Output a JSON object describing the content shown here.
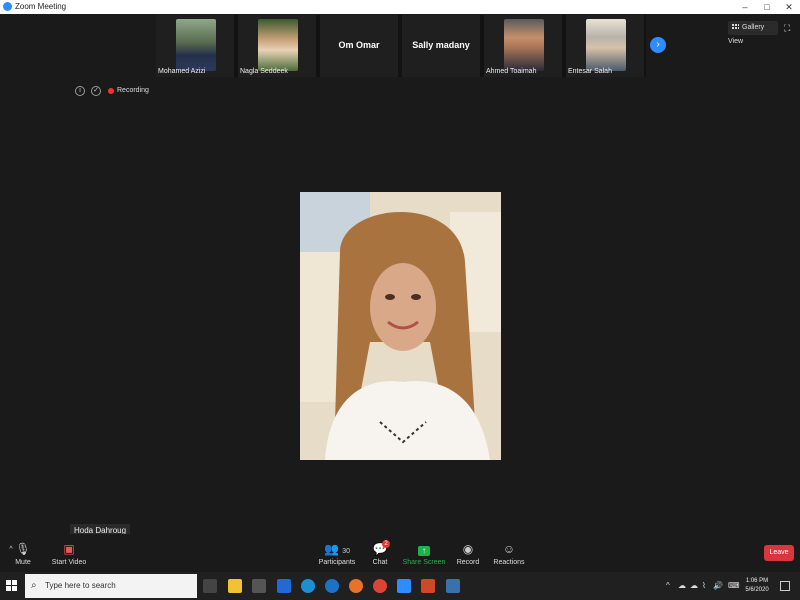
{
  "window": {
    "title": "Zoom Meeting",
    "controls": [
      "–",
      "□",
      "✕"
    ]
  },
  "participants_strip": {
    "tiles": [
      {
        "name": "Mohamed Azizi",
        "type": "video"
      },
      {
        "name": "Nagla Seddeek",
        "type": "video"
      },
      {
        "name": "Om Omar",
        "type": "name-only"
      },
      {
        "name": "Sally madany",
        "type": "name-only"
      },
      {
        "name": "Ahmed Toaimah",
        "type": "video"
      },
      {
        "name": "Entesar Salah",
        "type": "video"
      }
    ],
    "next_icon": "›"
  },
  "view": {
    "gallery_label": "Gallery View",
    "fullscreen_icon": "⛶"
  },
  "recording": {
    "label": "Recording",
    "info_icon": "i",
    "shield_icon": "✓"
  },
  "active_speaker": {
    "name": "Hoda Dahroug"
  },
  "toolbar": {
    "mute": "Mute",
    "start_video": "Start Video",
    "participants": "Participants",
    "participants_count": "30",
    "chat": "Chat",
    "chat_badge": "2",
    "share_screen": "Share Screen",
    "record": "Record",
    "reactions": "Reactions",
    "leave": "Leave"
  },
  "taskbar": {
    "search_placeholder": "Type here to search",
    "time": "1:06 PM",
    "date": "5/6/2020"
  },
  "colors": {
    "accent": "#2d8cff",
    "leave": "#d9363e",
    "share": "#1fb14b",
    "recording": "#e33333"
  }
}
